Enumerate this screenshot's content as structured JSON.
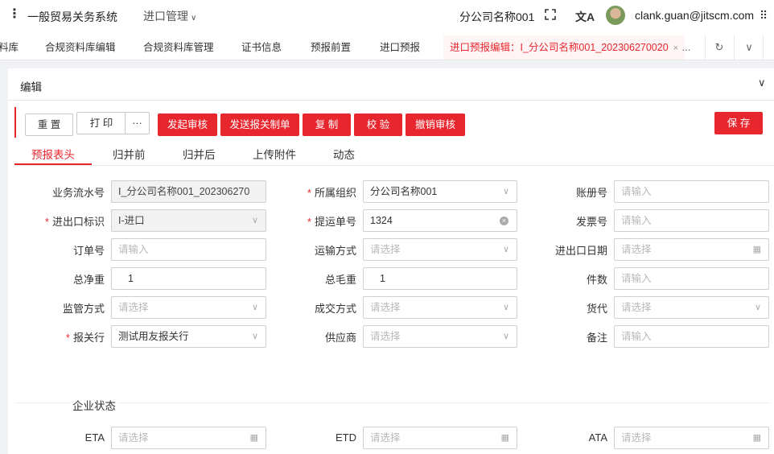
{
  "topbar": {
    "menu_glyph": "⋮",
    "app_title": "一般贸易关务系统",
    "module": "进口管理",
    "module_chevron": "∨",
    "company": "分公司名称001",
    "lang_glyph": "文A",
    "user": "clank.guan@jitscm.com",
    "more_glyph": "⠿"
  },
  "tabs": [
    {
      "label": "料库"
    },
    {
      "label": "合规资料库编辑"
    },
    {
      "label": "合规资料库管理"
    },
    {
      "label": "证书信息"
    },
    {
      "label": "预报前置"
    },
    {
      "label": "进口预报"
    },
    {
      "label": "进口预报编辑：I_分公司名称001_202306270020",
      "close": "×"
    }
  ],
  "tab_tools": {
    "more": "...",
    "refresh": "↻",
    "dropdown": "∨"
  },
  "panel": {
    "title": "编辑",
    "collapse": "∨"
  },
  "toolbar": {
    "reset": "重 置",
    "print": "打 印",
    "more": "···",
    "submit_review": "发起审核",
    "send_customs": "发送报关制单",
    "copy": "复 制",
    "verify": "校 验",
    "cancel_review": "撤销审核",
    "save": "保 存"
  },
  "subtabs": [
    "预报表头",
    "归并前",
    "归并后",
    "上传附件",
    "动态"
  ],
  "form": {
    "serial_no": {
      "label": "业务流水号",
      "value": "I_分公司名称001_202306270"
    },
    "org": {
      "label": "所属组织",
      "value": "分公司名称001"
    },
    "account_no": {
      "label": "账册号",
      "placeholder": "请输入"
    },
    "io_flag": {
      "label": "进出口标识",
      "value": "I-进口"
    },
    "bill_no": {
      "label": "提运单号",
      "value": "1324"
    },
    "invoice_no": {
      "label": "发票号",
      "placeholder": "请输入"
    },
    "order_no": {
      "label": "订单号",
      "placeholder": "请输入"
    },
    "transport": {
      "label": "运输方式",
      "placeholder": "请选择"
    },
    "io_date": {
      "label": "进出口日期",
      "placeholder": "请选择"
    },
    "net_weight": {
      "label": "总净重",
      "value": "1"
    },
    "gross_weight": {
      "label": "总毛重",
      "value": "1"
    },
    "pieces": {
      "label": "件数",
      "placeholder": "请输入"
    },
    "supervision": {
      "label": "监管方式",
      "placeholder": "请选择"
    },
    "deal_mode": {
      "label": "成交方式",
      "placeholder": "请选择"
    },
    "forwarder": {
      "label": "货代",
      "placeholder": "请选择"
    },
    "broker": {
      "label": "报关行",
      "value": "测试用友报关行"
    },
    "supplier": {
      "label": "供应商",
      "placeholder": "请选择"
    },
    "remark": {
      "label": "备注",
      "placeholder": "请输入"
    }
  },
  "enterprise": {
    "title": "企业状态",
    "eta": {
      "label": "ETA",
      "placeholder": "请选择"
    },
    "etd": {
      "label": "ETD",
      "placeholder": "请选择"
    },
    "ata": {
      "label": "ATA",
      "placeholder": "请选择"
    }
  },
  "required_mark": "*",
  "select_glyph": "∨",
  "calendar_glyph": "▦",
  "clear_glyph": "×"
}
